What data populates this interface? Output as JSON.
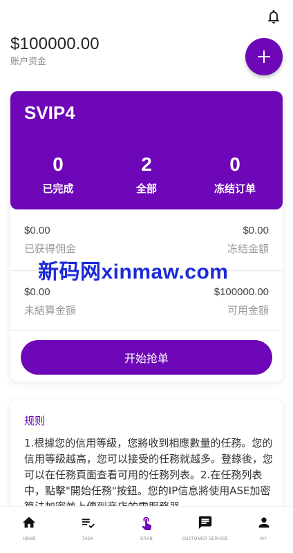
{
  "account": {
    "balance": "$100000.00",
    "balance_label": "账户资金"
  },
  "vip": {
    "level": "SVIP4",
    "stats": [
      {
        "value": "0",
        "label": "已完成"
      },
      {
        "value": "2",
        "label": "全部"
      },
      {
        "value": "0",
        "label": "冻结订单"
      }
    ]
  },
  "money": {
    "earned_commission": {
      "value": "$0.00",
      "label": "已获得佣金"
    },
    "frozen_amount": {
      "value": "$0.00",
      "label": "冻结金額"
    },
    "unsettled_amount": {
      "value": "$0.00",
      "label": "未結算金額"
    },
    "available_amount": {
      "value": "$100000.00",
      "label": "可用金額"
    }
  },
  "actions": {
    "start_grab_label": "开始抢单"
  },
  "watermark": "新码网xinmaw.com",
  "rules": {
    "title": "规则",
    "text": "1.根據您的信用等級，您將收到相應數量的任務。您的信用等級越高，您可以接受的任務就越多。登錄後，您可以在任務頁面查看可用的任務列表。2.在任務列表中，點擊\"開始任務\"按鈕。您的IP信息將使用ASE加密算法加密並上傳到商店的雲服務器。"
  },
  "tabbar": {
    "items": [
      {
        "label": "HOME",
        "icon": "home-icon"
      },
      {
        "label": "TASK",
        "icon": "playlist-check-icon"
      },
      {
        "label": "GRAB",
        "icon": "touch-app-icon"
      },
      {
        "label": "CUSTOMER SERVICE",
        "icon": "chat-icon"
      },
      {
        "label": "MY",
        "icon": "person-icon"
      }
    ],
    "active": "GRAB"
  },
  "colors": {
    "brand": "#6d07b8",
    "watermark": "#1b2bd6"
  }
}
